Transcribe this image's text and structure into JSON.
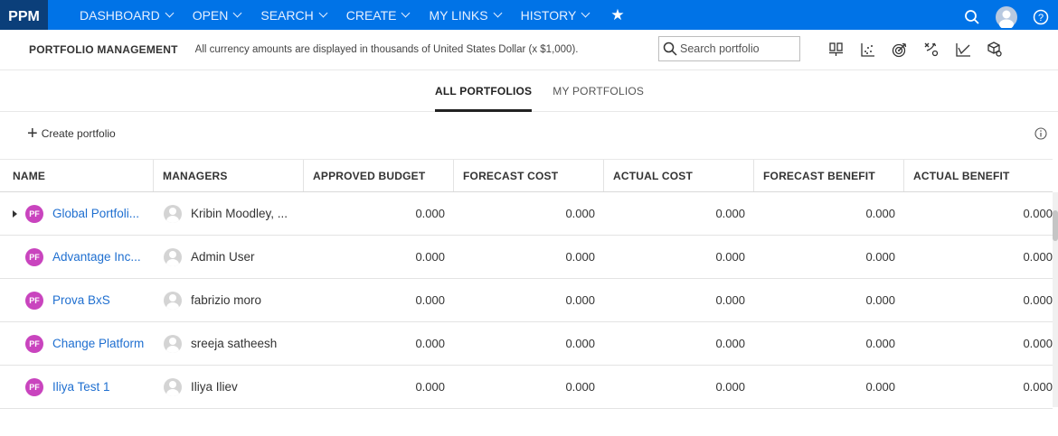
{
  "app": {
    "logo": "PPM"
  },
  "nav": {
    "items": [
      {
        "label": "DASHBOARD"
      },
      {
        "label": "OPEN"
      },
      {
        "label": "SEARCH"
      },
      {
        "label": "CREATE"
      },
      {
        "label": "MY LINKS"
      },
      {
        "label": "HISTORY"
      }
    ],
    "favorite_icon": "star-icon",
    "right_icons": [
      "search-icon",
      "user-avatar-icon",
      "help-icon"
    ]
  },
  "header": {
    "title": "PORTFOLIO MANAGEMENT",
    "note": "All currency amounts are displayed in thousands of United States Dollar (x $1,000).",
    "search_placeholder": "Search portfolio",
    "tools": [
      "portfolio-chart-icon",
      "scatter-chart-icon",
      "target-icon",
      "transfer-icon",
      "line-chart-icon",
      "cube-settings-icon"
    ]
  },
  "tabs": [
    {
      "label": "ALL PORTFOLIOS",
      "active": true
    },
    {
      "label": "MY PORTFOLIOS",
      "active": false
    }
  ],
  "actions": {
    "create_label": "Create portfolio"
  },
  "table": {
    "columns": [
      "NAME",
      "MANAGERS",
      "APPROVED BUDGET",
      "FORECAST COST",
      "ACTUAL COST",
      "FORECAST BENEFIT",
      "ACTUAL BENEFIT"
    ],
    "badge": "PF",
    "rows": [
      {
        "name": "Global Portfoli...",
        "manager": "Kribin Moodley, ...",
        "approved_budget": "0.000",
        "forecast_cost": "0.000",
        "actual_cost": "0.000",
        "forecast_benefit": "0.000",
        "actual_benefit": "0.000",
        "expandable": true
      },
      {
        "name": "Advantage Inc...",
        "manager": "Admin User",
        "approved_budget": "0.000",
        "forecast_cost": "0.000",
        "actual_cost": "0.000",
        "forecast_benefit": "0.000",
        "actual_benefit": "0.000",
        "expandable": false
      },
      {
        "name": "Prova BxS",
        "manager": "fabrizio moro",
        "approved_budget": "0.000",
        "forecast_cost": "0.000",
        "actual_cost": "0.000",
        "forecast_benefit": "0.000",
        "actual_benefit": "0.000",
        "expandable": false
      },
      {
        "name": "Change Platform",
        "manager": "sreeja satheesh",
        "approved_budget": "0.000",
        "forecast_cost": "0.000",
        "actual_cost": "0.000",
        "forecast_benefit": "0.000",
        "actual_benefit": "0.000",
        "expandable": false
      },
      {
        "name": "Iliya Test 1",
        "manager": "Iliya Iliev",
        "approved_budget": "0.000",
        "forecast_cost": "0.000",
        "actual_cost": "0.000",
        "forecast_benefit": "0.000",
        "actual_benefit": "0.000",
        "expandable": false
      }
    ]
  },
  "colors": {
    "nav_bg": "#0073e7",
    "logo_bg": "#0b3f7a",
    "badge": "#c944be",
    "link": "#1f6fd0"
  }
}
